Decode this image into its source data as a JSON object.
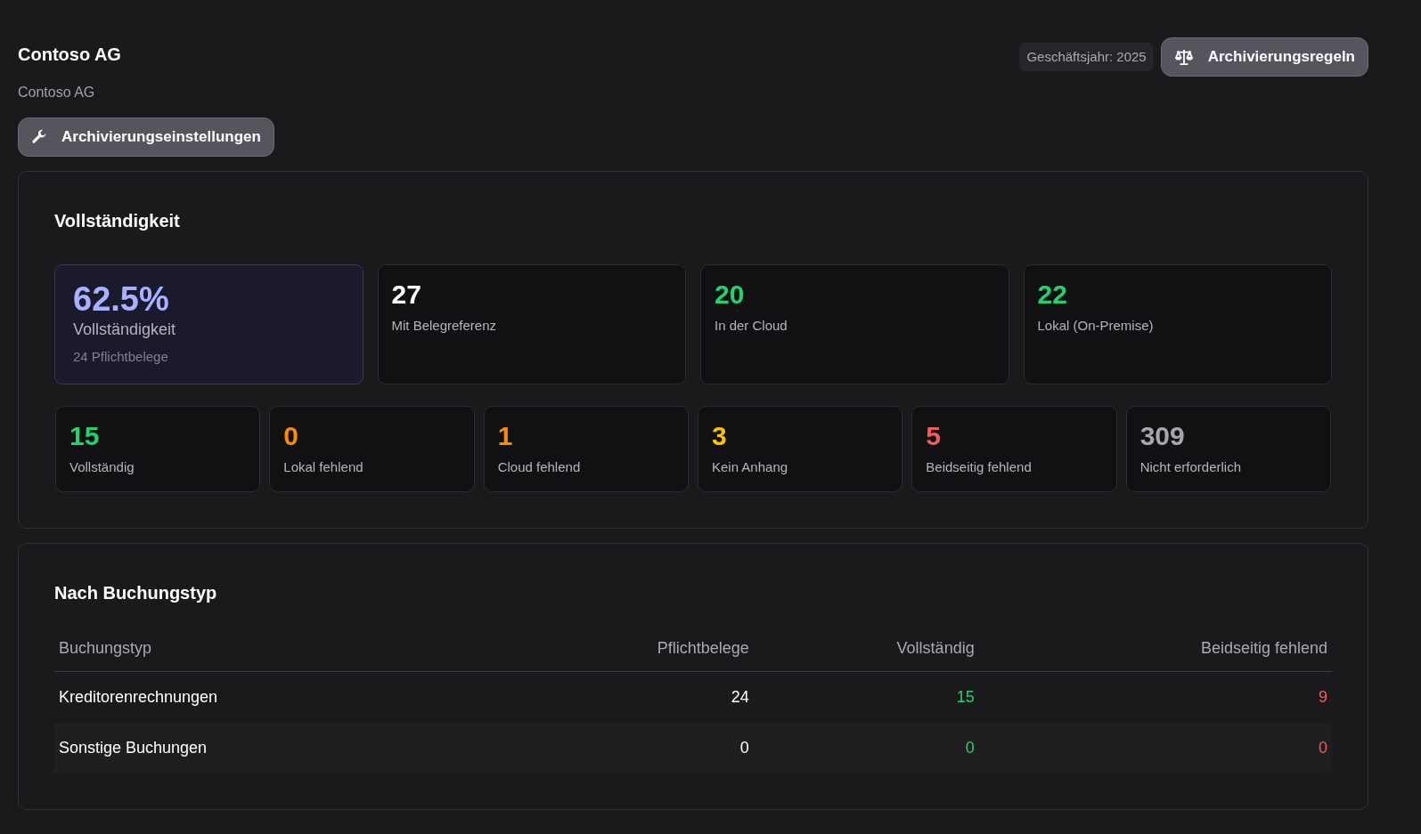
{
  "header": {
    "title": "Contoso AG",
    "subtitle": "Contoso AG",
    "settings_button": "Archivierungseinstellungen",
    "fiscal_year": "Geschäftsjahr: 2025",
    "rules_button": "Archivierungsregeln"
  },
  "completeness": {
    "title": "Vollständigkeit",
    "highlight": {
      "value": "62.5%",
      "label": "Vollständigkeit",
      "note": "24 Pflichtbelege"
    },
    "top_stats": [
      {
        "value": "27",
        "label": "Mit Belegreferenz",
        "color": "#ffffff"
      },
      {
        "value": "20",
        "label": "In der Cloud",
        "color": "#22d36b"
      },
      {
        "value": "22",
        "label": "Lokal (On-Premise)",
        "color": "#22d36b"
      }
    ],
    "stats": [
      {
        "value": "15",
        "label": "Vollständig",
        "color": "#22d36b"
      },
      {
        "value": "0",
        "label": "Lokal fehlend",
        "color": "#ff8a00"
      },
      {
        "value": "1",
        "label": "Cloud fehlend",
        "color": "#ff8a00"
      },
      {
        "value": "3",
        "label": "Kein Anhang",
        "color": "#ffc107"
      },
      {
        "value": "5",
        "label": "Beidseitig fehlend",
        "color": "#f25c5c"
      },
      {
        "value": "309",
        "label": "Nicht erforderlich",
        "color": "#a6a6ad"
      }
    ]
  },
  "by_type": {
    "title": "Nach Buchungstyp",
    "columns": [
      {
        "label": "Buchungstyp",
        "color": "#ffffff"
      },
      {
        "label": "Pflichtbelege",
        "color": "#ffffff"
      },
      {
        "label": "Vollständig",
        "color": "#22d36b"
      },
      {
        "label": "Beidseitig fehlend",
        "color": "#f25c5c"
      }
    ],
    "rows": [
      [
        "Kreditorenrechnungen",
        "24",
        "15",
        "9"
      ],
      [
        "Sonstige Buchungen",
        "0",
        "0",
        "0"
      ]
    ]
  }
}
